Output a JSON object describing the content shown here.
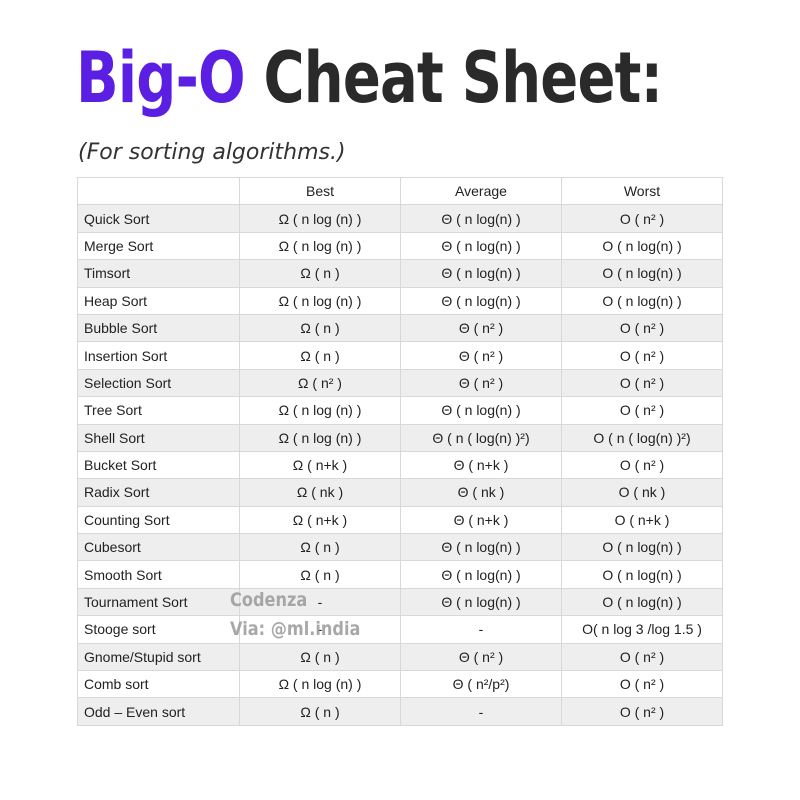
{
  "title": {
    "accent": "Big-O",
    "rest": " Cheat Sheet:"
  },
  "subtitle": "(For sorting algorithms.)",
  "table": {
    "headers": [
      "",
      "Best",
      "Average",
      "Worst"
    ],
    "rows": [
      [
        "Quick Sort",
        "Ω ( n log (n) )",
        "Θ ( n log(n) )",
        "O ( n² )"
      ],
      [
        "Merge Sort",
        "Ω ( n log (n) )",
        "Θ ( n log(n) )",
        "O ( n log(n) )"
      ],
      [
        "Timsort",
        "Ω ( n )",
        "Θ ( n log(n) )",
        "O ( n log(n) )"
      ],
      [
        "Heap Sort",
        "Ω ( n log (n) )",
        "Θ ( n log(n) )",
        "O ( n log(n) )"
      ],
      [
        "Bubble Sort",
        "Ω ( n )",
        "Θ ( n² )",
        "O ( n² )"
      ],
      [
        "Insertion Sort",
        "Ω ( n )",
        "Θ ( n² )",
        "O ( n² )"
      ],
      [
        "Selection Sort",
        "Ω ( n² )",
        "Θ ( n² )",
        "O ( n² )"
      ],
      [
        "Tree Sort",
        "Ω ( n log (n) )",
        "Θ ( n log(n) )",
        "O ( n² )"
      ],
      [
        "Shell Sort",
        "Ω ( n log (n) )",
        "Θ ( n ( log(n) )²)",
        "O ( n ( log(n) )²)"
      ],
      [
        "Bucket Sort",
        "Ω ( n+k )",
        "Θ ( n+k )",
        "O ( n² )"
      ],
      [
        "Radix Sort",
        "Ω ( nk )",
        "Θ ( nk )",
        "O ( nk )"
      ],
      [
        "Counting Sort",
        "Ω ( n+k )",
        "Θ ( n+k )",
        "O ( n+k )"
      ],
      [
        "Cubesort",
        "Ω ( n )",
        "Θ ( n log(n) )",
        "O ( n log(n) )"
      ],
      [
        "Smooth Sort",
        "Ω ( n )",
        "Θ ( n log(n) )",
        "O ( n log(n) )"
      ],
      [
        "Tournament Sort",
        "-",
        "Θ ( n log(n) )",
        "O ( n log(n) )"
      ],
      [
        "Stooge sort",
        "-",
        "-",
        "O( n log 3 /log 1.5 )"
      ],
      [
        "Gnome/Stupid sort",
        "Ω ( n )",
        "Θ ( n² )",
        "O ( n² )"
      ],
      [
        "Comb sort",
        "Ω ( n log (n) )",
        "Θ ( n²/p²)",
        "O ( n² )"
      ],
      [
        "Odd – Even sort",
        "Ω ( n )",
        "-",
        "O ( n² )"
      ]
    ]
  },
  "watermark": {
    "line1": "Codenza",
    "line2": "Via: @ml.india"
  }
}
